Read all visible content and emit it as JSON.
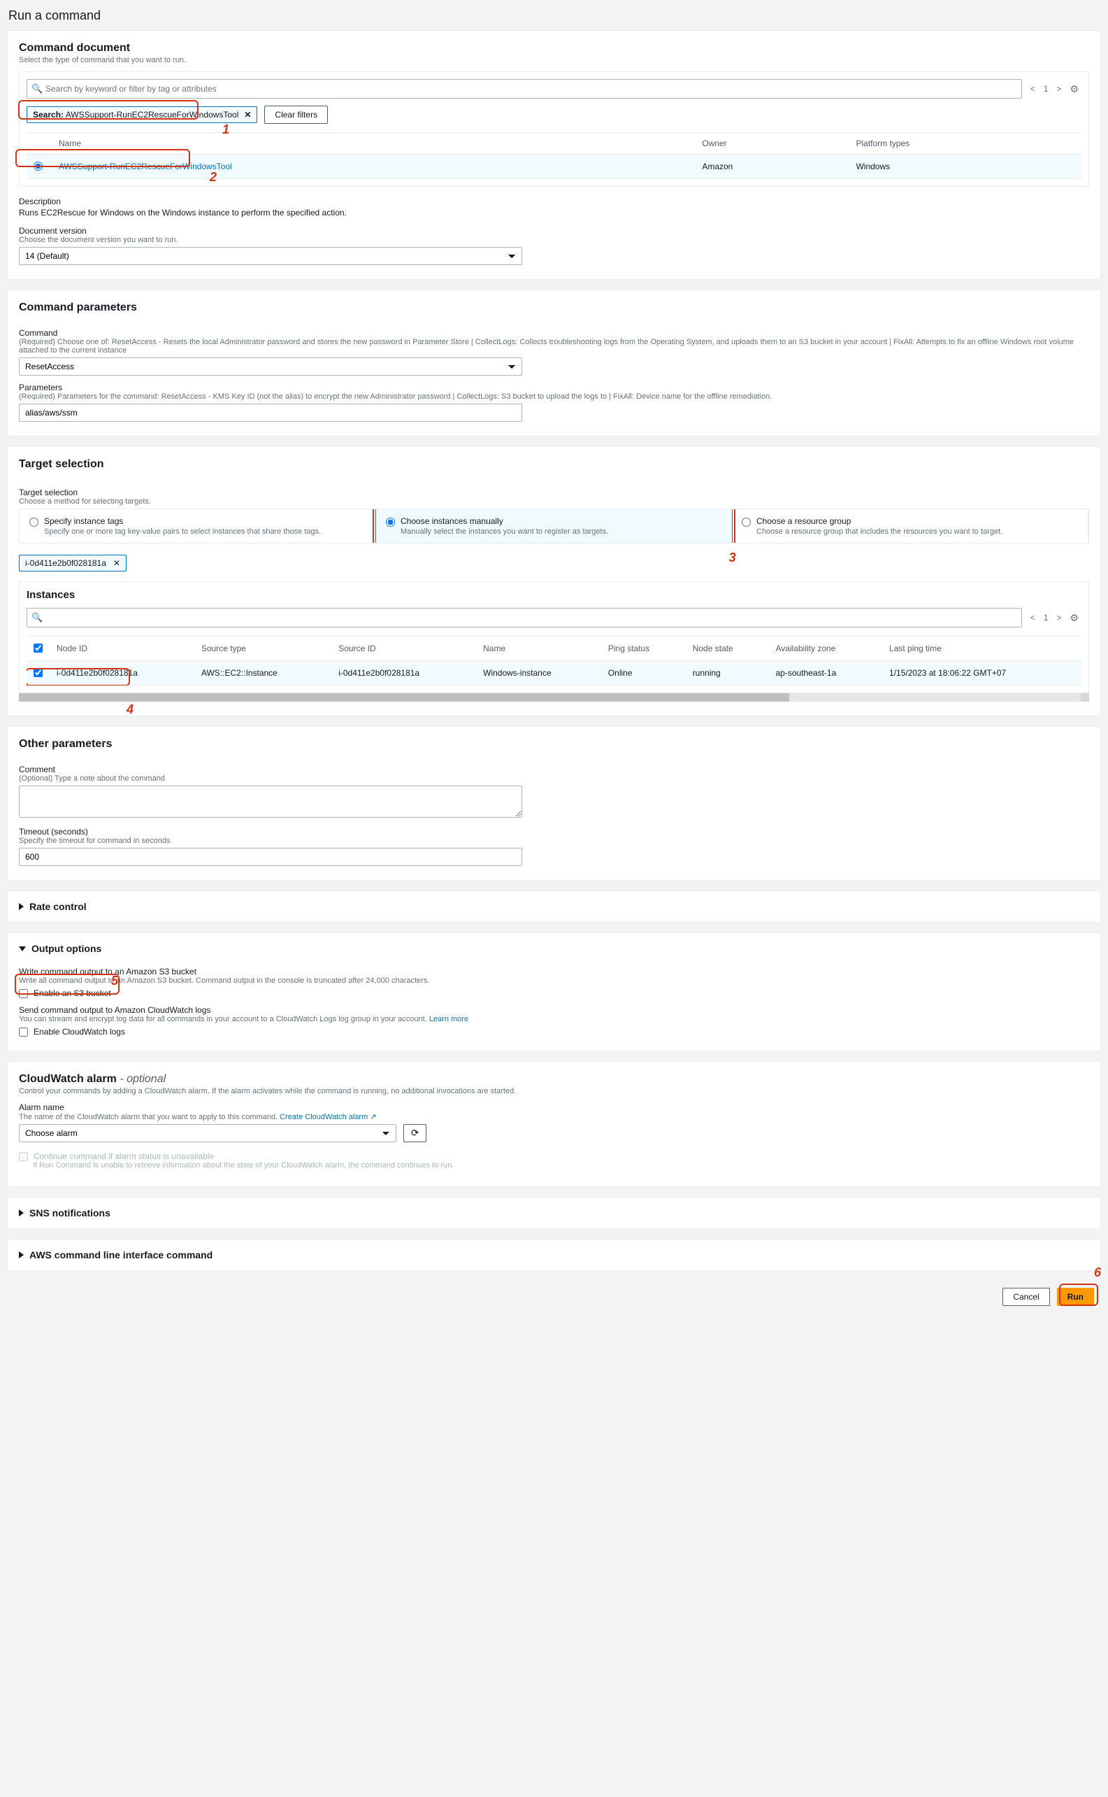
{
  "page_title": "Run a command",
  "doc": {
    "heading": "Command document",
    "sub": "Select the type of command that you want to run.",
    "search_placeholder": "Search by keyword or filter by tag or attributes",
    "chip_label": "Search:",
    "chip_value": "AWSSupport-RunEC2RescueForWindowsTool",
    "clear_filters": "Clear filters",
    "pager_page": "1",
    "cols": {
      "name": "Name",
      "owner": "Owner",
      "platform": "Platform types"
    },
    "row": {
      "name": "AWSSupport-RunEC2RescueForWindowsTool",
      "owner": "Amazon",
      "platform": "Windows"
    },
    "desc_label": "Description",
    "desc_text": "Runs EC2Rescue for Windows on the Windows instance to perform the specified action.",
    "ver_label": "Document version",
    "ver_sub": "Choose the document version you want to run.",
    "ver_value": "14 (Default)"
  },
  "params": {
    "heading": "Command parameters",
    "cmd_label": "Command",
    "cmd_sub": "(Required) Choose one of: ResetAccess - Resets the local Administrator password and stores the new password in Parameter Store | CollectLogs: Collects troubleshooting logs from the Operating System, and uploads them to an S3 bucket in your account | FixAll: Attempts to fix an offline Windows root volume attached to the current instance",
    "cmd_value": "ResetAccess",
    "p_label": "Parameters",
    "p_sub": "(Required) Parameters for the command: ResetAccess - KMS Key ID (not the alias) to encrypt the new Administrator password | CollectLogs: S3 bucket to upload the logs to | FixAll: Device name for the offline remediation.",
    "p_value": "alias/aws/ssm"
  },
  "target": {
    "heading": "Target selection",
    "sel_label": "Target selection",
    "sel_sub": "Choose a method for selecting targets.",
    "tiles": {
      "tags": {
        "title": "Specify instance tags",
        "sub": "Specify one or more tag key-value pairs to select instances that share those tags."
      },
      "manual": {
        "title": "Choose instances manually",
        "sub": "Manually select the instances you want to register as targets."
      },
      "rg": {
        "title": "Choose a resource group",
        "sub": "Choose a resource group that includes the resources you want to target."
      }
    },
    "chip_instance": "i-0d411e2b0f028181a",
    "inst": {
      "heading": "Instances",
      "pager_page": "1",
      "cols": {
        "node": "Node ID",
        "stype": "Source type",
        "sid": "Source ID",
        "name": "Name",
        "ping": "Ping status",
        "state": "Node state",
        "az": "Availability zone",
        "lpt": "Last ping time"
      },
      "row": {
        "node": "i-0d411e2b0f028181a",
        "stype": "AWS::EC2::Instance",
        "sid": "i-0d411e2b0f028181a",
        "name": "Windows-instance",
        "ping": "Online",
        "state": "running",
        "az": "ap-southeast-1a",
        "lpt": "1/15/2023 at 18:06:22 GMT+07"
      }
    }
  },
  "other": {
    "heading": "Other parameters",
    "comment_label": "Comment",
    "comment_sub": "(Optional) Type a note about the command",
    "timeout_label": "Timeout (seconds)",
    "timeout_sub": "Specify the timeout for command in seconds",
    "timeout_value": "600"
  },
  "rate": {
    "heading": "Rate control"
  },
  "output": {
    "heading": "Output options",
    "s3_label": "Write command output to an Amazon S3 bucket",
    "s3_sub": "Write all command output to an Amazon S3 bucket. Command output in the console is truncated after 24,000 characters.",
    "s3_check": "Enable an S3 bucket",
    "cw_label": "Send command output to Amazon CloudWatch logs",
    "cw_sub": "You can stream and encrypt log data for all commands in your account to a CloudWatch Logs log group in your account. ",
    "learn_more": "Learn more",
    "cw_check": "Enable CloudWatch logs"
  },
  "alarm": {
    "heading_a": "CloudWatch alarm",
    "heading_b": " - optional",
    "sub": "Control your commands by adding a CloudWatch alarm. If the alarm activates while the command is running, no additional invocations are started.",
    "name_label": "Alarm name",
    "name_sub_a": "The name of the CloudWatch alarm that you want to apply to this command. ",
    "name_sub_link": "Create CloudWatch alarm",
    "select_value": "Choose alarm",
    "cont_label": "Continue command if alarm status is unavailable",
    "cont_sub": "If Run Command is unable to retrieve information about the state of your CloudWatch alarm, the command continues to run."
  },
  "sns": {
    "heading": "SNS notifications"
  },
  "cli": {
    "heading": "AWS command line interface command"
  },
  "footer": {
    "cancel": "Cancel",
    "run": "Run"
  },
  "anno": {
    "a1": "1",
    "a2": "2",
    "a3": "3",
    "a4": "4",
    "a5": "5",
    "a6": "6"
  }
}
